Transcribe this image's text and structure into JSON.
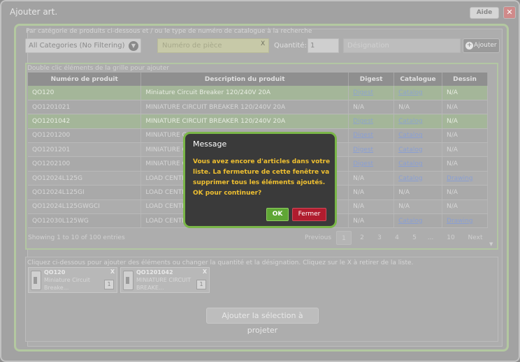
{
  "window": {
    "title": "Ajouter art.",
    "help_label": "Aide",
    "close_label": "✕"
  },
  "filters": {
    "label": "Par catégorie de produits ci-dessous et / ou le type de numéro de catalogue à la recherche",
    "category_value": "All Categories (No Filtering)",
    "part_placeholder": "Numéro de pièce",
    "part_clear": "X",
    "quantity_label": "Quantité:",
    "quantity_value": "1",
    "designation_placeholder": "Désignation",
    "add_label": "Ajouter"
  },
  "grid": {
    "hint": "Double clic éléments de la grille pour ajouter",
    "headers": [
      "Numéro de produit",
      "Description du produit",
      "Digest",
      "Catalogue",
      "Dessin"
    ],
    "rows": [
      [
        "QO120",
        "Miniature Circuit Breaker 120/240V 20A",
        "Digest",
        "Catalog",
        "N/A"
      ],
      [
        "QO1201021",
        "MINIATURE CIRCUIT BREAKER 120/240V 20A",
        "N/A",
        "N/A",
        "N/A"
      ],
      [
        "QO1201042",
        "MINIATURE CIRCUIT BREAKER 120/240V 20A",
        "Digest",
        "Catalog",
        "N/A"
      ],
      [
        "QO1201200",
        "MINIATURE C",
        "Digest",
        "Catalog",
        "N/A"
      ],
      [
        "QO1201201",
        "MINIATURE C",
        "Digest",
        "Catalog",
        "N/A"
      ],
      [
        "QO1202100",
        "MINIATURE C",
        "Digest",
        "Catalog",
        "N/A"
      ],
      [
        "QO12024L125G",
        "LOAD CENTER",
        "N/A",
        "Catalog",
        "Drawing"
      ],
      [
        "QO12024L125GI",
        "LOAD CENTER",
        "N/A",
        "N/A",
        "N/A"
      ],
      [
        "QO12024L125GWGCI",
        "LOAD CENTER",
        "N/A",
        "N/A",
        "N/A"
      ],
      [
        "QO12030L125WG",
        "LOAD CENTER",
        "N/A",
        "Catalog",
        "Drawing"
      ]
    ],
    "selected_rows": [
      0,
      2
    ],
    "paging_info": "Showing 1 to 10 of 100 entries",
    "pager": {
      "previous": "Previous",
      "pages": [
        "1",
        "2",
        "3",
        "4",
        "5",
        "...",
        "10"
      ],
      "current": "1",
      "next": "Next"
    }
  },
  "selection": {
    "hint": "Cliquez ci-dessous pour ajouter des éléments ou changer la quantité et la désignation. Cliquez sur le X à retirer de la liste.",
    "items": [
      {
        "code": "QO120",
        "desc": "Miniature Circuit Breake...",
        "qty": "1",
        "remove": "X"
      },
      {
        "code": "QO1201042",
        "desc": "MINIATURE CIRCUIT BREAKE...",
        "qty": "1",
        "remove": "X"
      }
    ],
    "project_label": "Ajouter la sélection à projeter"
  },
  "modal": {
    "title": "Message",
    "body": "Vous avez encore d'articles dans votre liste. La fermeture de cette fenêtre va supprimer tous les éléments ajoutés. OK pour continuer?",
    "ok_label": "OK",
    "close_label": "Fermer"
  }
}
